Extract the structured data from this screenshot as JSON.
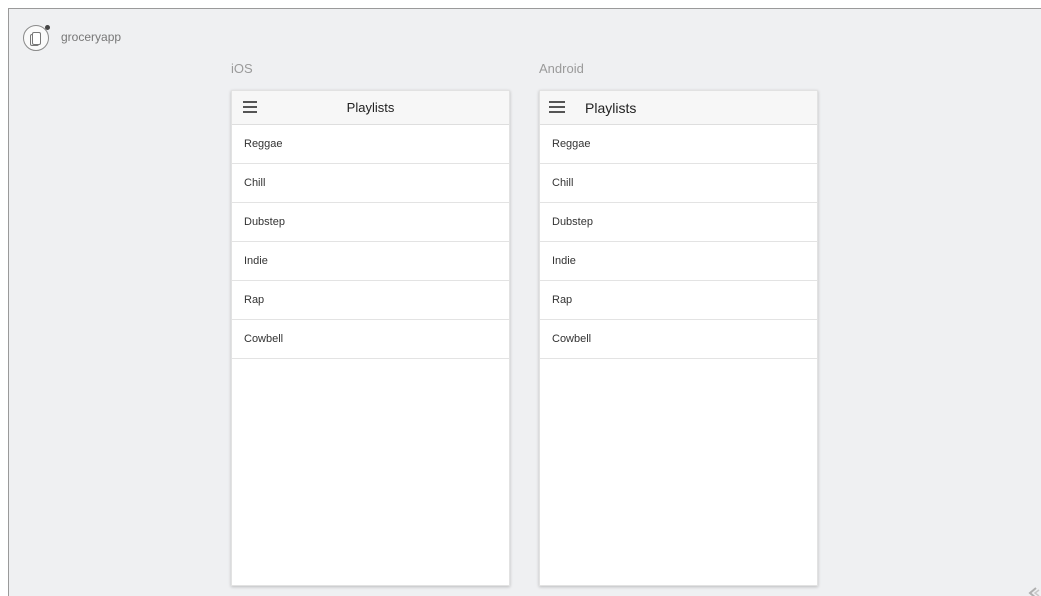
{
  "app": {
    "name": "groceryapp"
  },
  "previews": {
    "ios": {
      "platform_label": "iOS",
      "title": "Playlists",
      "items": [
        "Reggae",
        "Chill",
        "Dubstep",
        "Indie",
        "Rap",
        "Cowbell"
      ]
    },
    "android": {
      "platform_label": "Android",
      "title": "Playlists",
      "items": [
        "Reggae",
        "Chill",
        "Dubstep",
        "Indie",
        "Rap",
        "Cowbell"
      ]
    }
  },
  "icons": {
    "app_logo": "app-logo-icon",
    "menu": "hamburger-menu-icon",
    "corner": "arrow-icon"
  }
}
